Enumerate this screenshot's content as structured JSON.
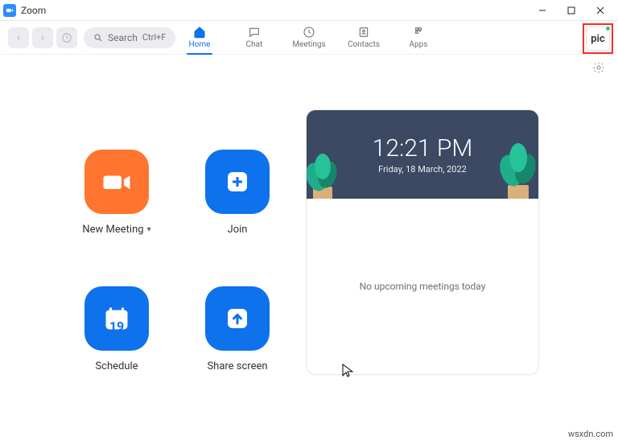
{
  "window": {
    "title": "Zoom"
  },
  "toolbar": {
    "search_label": "Search",
    "search_shortcut": "Ctrl+F"
  },
  "tabs": {
    "home": "Home",
    "chat": "Chat",
    "meetings": "Meetings",
    "contacts": "Contacts",
    "apps": "Apps"
  },
  "profile": {
    "text": "pic"
  },
  "actions": {
    "new_meeting": "New Meeting",
    "join": "Join",
    "schedule": "Schedule",
    "share_screen": "Share screen",
    "schedule_day": "19"
  },
  "clock": {
    "time": "12:21 PM",
    "date": "Friday, 18 March, 2022",
    "empty_msg": "No upcoming meetings today"
  },
  "watermark": "wsxdn.com"
}
